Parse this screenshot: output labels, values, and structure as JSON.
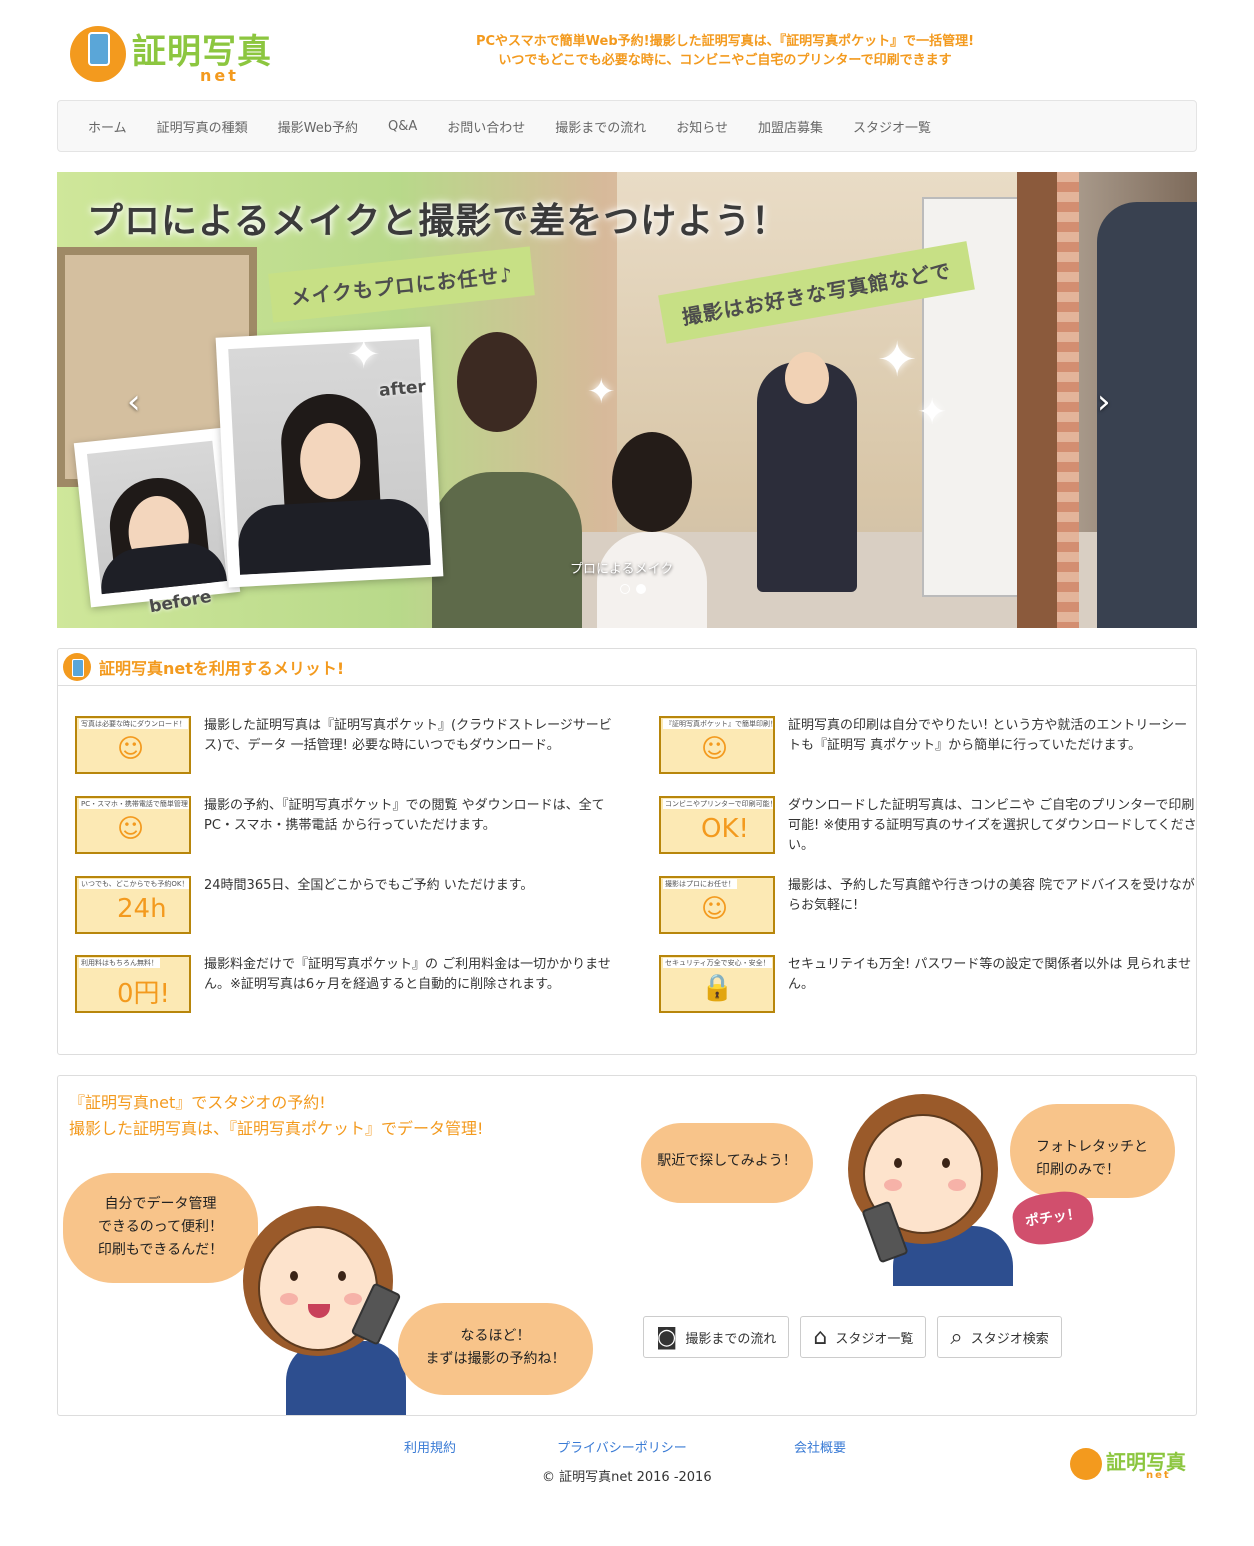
{
  "header": {
    "logo_text": "証明写真",
    "logo_sub": "net",
    "tagline_1": "PCやスマホで簡単Web予約!撮影した証明写真は、『証明写真ポケット』で一括管理!",
    "tagline_2": "いつでもどこでも必要な時に、コンビニやご自宅のプリンターで印刷できます"
  },
  "nav": {
    "items": [
      "ホーム",
      "証明写真の種類",
      "撮影Web予約",
      "Q&A",
      "お問い合わせ",
      "撮影までの流れ",
      "お知らせ",
      "加盟店募集",
      "スタジオ一覧"
    ]
  },
  "hero": {
    "title": "プロによるメイクと撮影で差をつけよう！",
    "ribbon_1": "メイクもプロにお任せ♪",
    "ribbon_2": "撮影はお好きな写真館などで",
    "tag_after": "after",
    "tag_before": "before",
    "caption": "プロによるメイク",
    "prev_arrow": "‹",
    "next_arrow": "›",
    "slides": 2,
    "active_slide": 2,
    "icons": [
      "chevron-left-icon",
      "chevron-right-icon"
    ]
  },
  "merits": {
    "title": "証明写真netを利用するメリット!",
    "items": [
      {
        "thumb_label": "写真は必要な時にダウンロード！",
        "art": "☺",
        "text": "撮影した証明写真は『証明写真ポケット』(クラウドストレージサービス)で、データ 一括管理! 必要な時にいつでもダウンロード。"
      },
      {
        "thumb_label": "PC・スマホ・携帯電話で簡単管理！",
        "art": "☺",
        "text": "撮影の予約、『証明写真ポケット』での閲覧 やダウンロードは、全てPC・スマホ・携帯電話 から行っていただけます。"
      },
      {
        "thumb_label": "いつでも、どこからでも予約OK！",
        "art": "24h",
        "text": "24時間365日、全国どこからでもご予約 いただけます。"
      },
      {
        "thumb_label": "利用料はもちろん無料！",
        "art": "0円!",
        "text": "撮影料金だけで『証明写真ポケット』の ご利用料金は一切かかりません。※証明写真は6ヶ月を経過すると自動的に削除されます。"
      },
      {
        "thumb_label": "『証明写真ポケット』で簡単印刷！",
        "art": "☺",
        "text": "証明写真の印刷は自分でやりたい! という方や就活のエントリーシートも『証明写 真ポケット』から簡単に行っていただけます。"
      },
      {
        "thumb_label": "コンビニやプリンターで印刷可能！",
        "art": "OK!",
        "text": "ダウンロードした証明写真は、コンビニや ご自宅のプリンターで印刷可能! ※使用する証明写真のサイズを選択してダウンロードしてください。"
      },
      {
        "thumb_label": "撮影はプロにお任せ！",
        "art": "☺",
        "text": "撮影は、予約した写真館や行きつけの美容 院でアドバイスを受けながらお気軽に!"
      },
      {
        "thumb_label": "セキュリティ万全で安心・安全！",
        "art": "🔒",
        "text": "セキュリテイも万全! パスワード等の設定で関係者以外は 見られません。"
      }
    ]
  },
  "promo": {
    "line_1": "『証明写真net』でスタジオの予約!",
    "line_2": "撮影した証明写真は、『証明写真ポケット』でデータ管理!",
    "bubble_1_a": "自分でデータ管理",
    "bubble_1_b": "できるのって便利！",
    "bubble_1_c": "印刷もできるんだ！",
    "bubble_2_a": "なるほど！",
    "bubble_2_b": "まずは撮影の予約ね！",
    "bubble_3": "駅近で探してみよう！",
    "bubble_4_a": "フォトレタッチと",
    "bubble_4_b": "印刷のみで！",
    "pochi": "ポチッ！",
    "buttons": [
      {
        "label": "撮影までの流れ",
        "icon": "camera-icon",
        "glyph": "◙"
      },
      {
        "label": "スタジオ一覧",
        "icon": "home-icon",
        "glyph": "⌂"
      },
      {
        "label": "スタジオ検索",
        "icon": "search-icon",
        "glyph": "⌕"
      }
    ]
  },
  "footer": {
    "links": [
      "利用規約",
      "プライバシーポリシー",
      "会社概要"
    ],
    "copyright": "© 証明写真net 2016 -2016",
    "logo_text": "証明写真",
    "logo_sub": "net"
  },
  "colors": {
    "accent": "#f39a1e",
    "brand_green": "#8cc63f",
    "link": "#3a7bd5",
    "bubble": "#f8c48a"
  }
}
